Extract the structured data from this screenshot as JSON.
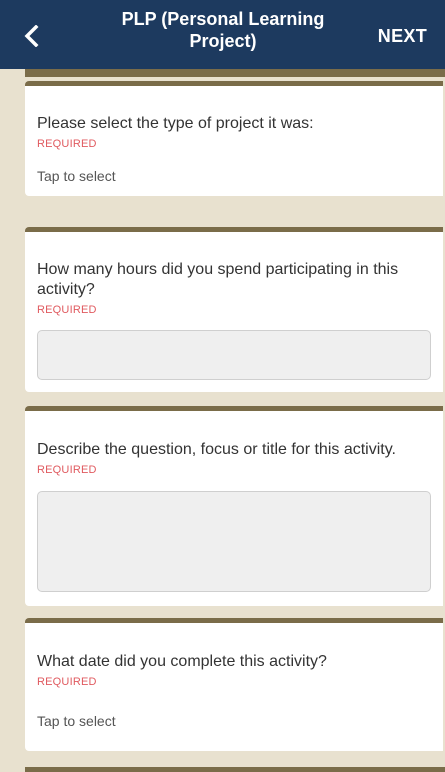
{
  "header": {
    "title": "PLP (Personal Learning Project)",
    "next_label": "NEXT",
    "back_icon": "chevron-left-icon",
    "background": "#1d3a5f"
  },
  "questions": [
    {
      "text": "Please select the type of project it was:",
      "required": "REQUIRED",
      "value": "Tap to select"
    },
    {
      "text": "How many hours did you spend participating in this activity?",
      "required": "REQUIRED",
      "value": ""
    },
    {
      "text": "Describe the question, focus or title for this activity.",
      "required": "REQUIRED",
      "value": ""
    },
    {
      "text": "What date did you complete this activity?",
      "required": "REQUIRED",
      "value": "Tap to select"
    }
  ],
  "colors": {
    "page_background": "#e8e1cf",
    "card_border": "#7a6c49",
    "required": "#e05a5f"
  }
}
